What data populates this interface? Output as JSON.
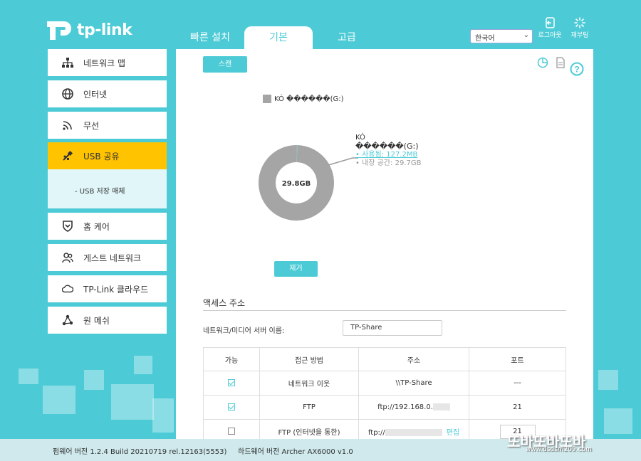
{
  "brand": {
    "name": "tp-link"
  },
  "nav_tabs": [
    {
      "label": "빠른 설치"
    },
    {
      "label": "기본"
    },
    {
      "label": "고급"
    }
  ],
  "language": {
    "selected": "한국어"
  },
  "top_actions": {
    "logout": "로그아웃",
    "reboot": "재부팅"
  },
  "sidebar": {
    "items": [
      {
        "label": "네트워크 맵",
        "icon": "network-map-icon"
      },
      {
        "label": "인터넷",
        "icon": "globe-icon"
      },
      {
        "label": "무선",
        "icon": "wifi-icon"
      },
      {
        "label": "USB 공유",
        "icon": "usb-icon"
      },
      {
        "label": "홈 케어",
        "icon": "shield-icon"
      },
      {
        "label": "게스트 네트워크",
        "icon": "guests-icon"
      },
      {
        "label": "TP-Link 클라우드",
        "icon": "cloud-icon"
      },
      {
        "label": "원 메쉬",
        "icon": "mesh-icon"
      }
    ],
    "sub_item": "- USB 저장 매체"
  },
  "main": {
    "scan_label": "스캔",
    "remove_label": "제거",
    "legend_label": "KÓ ������(G:)",
    "device": {
      "name_line1": "KÓ",
      "name_line2": "������(G:)",
      "used": "• 사용됨: 127.2MB",
      "free": "• 내장 공간: 29.7GB",
      "total": "29.8GB"
    },
    "access_title": "액세스 주소",
    "server_label": "네트워크/미디어 서버 이름:",
    "server_value": "TP-Share",
    "table": {
      "headers": [
        "가능",
        "접근 방법",
        "주소",
        "포트"
      ],
      "rows": [
        {
          "enabled": true,
          "method": "네트워크 이웃",
          "address": "\\\\TP-Share",
          "port": "---"
        },
        {
          "enabled": true,
          "method": "FTP",
          "address": "ftp://192.168.0.",
          "port": "21"
        },
        {
          "enabled": false,
          "method": "FTP (인터넷을 통한)",
          "address": "ftp://",
          "port": "21",
          "edit": "편집"
        }
      ]
    }
  },
  "footer": {
    "firmware": "펌웨어 버전 1.2.4 Build 20210719 rel.12163(5553)",
    "hardware": "하드웨어 버전 Archer AX6000 v1.0"
  },
  "watermark": {
    "title": "또바또바또바",
    "url": "www.dsdsm209.com"
  },
  "colors": {
    "accent": "#4ccbd6",
    "active": "#ffc300",
    "storage": "#a5a5a5"
  },
  "chart_data": {
    "type": "pie",
    "categories": [
      "사용됨",
      "내장 공간"
    ],
    "values": [
      127.2,
      30412.8
    ],
    "units": "MB",
    "center_label": "29.8GB"
  }
}
